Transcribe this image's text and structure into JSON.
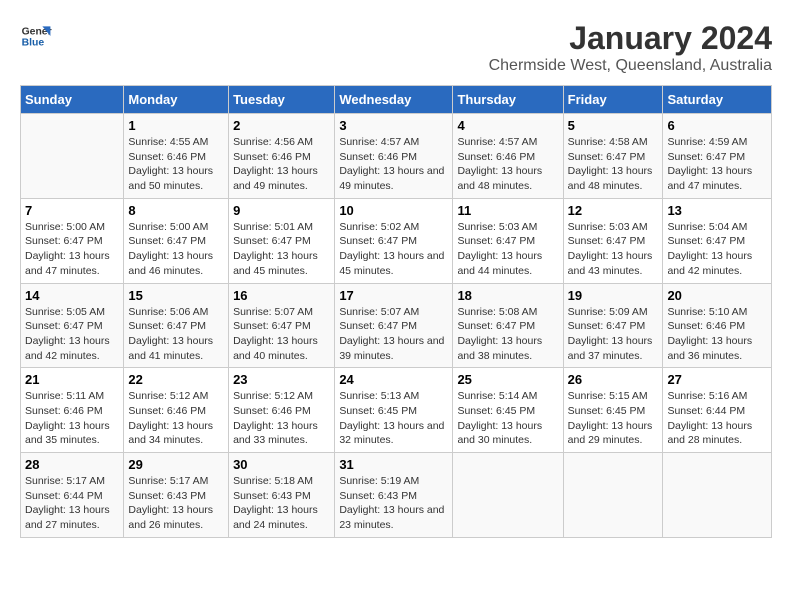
{
  "logo": {
    "line1": "General",
    "line2": "Blue"
  },
  "title": "January 2024",
  "subtitle": "Chermside West, Queensland, Australia",
  "headers": [
    "Sunday",
    "Monday",
    "Tuesday",
    "Wednesday",
    "Thursday",
    "Friday",
    "Saturday"
  ],
  "weeks": [
    [
      {
        "day": "",
        "sunrise": "",
        "sunset": "",
        "daylight": ""
      },
      {
        "day": "1",
        "sunrise": "Sunrise: 4:55 AM",
        "sunset": "Sunset: 6:46 PM",
        "daylight": "Daylight: 13 hours and 50 minutes."
      },
      {
        "day": "2",
        "sunrise": "Sunrise: 4:56 AM",
        "sunset": "Sunset: 6:46 PM",
        "daylight": "Daylight: 13 hours and 49 minutes."
      },
      {
        "day": "3",
        "sunrise": "Sunrise: 4:57 AM",
        "sunset": "Sunset: 6:46 PM",
        "daylight": "Daylight: 13 hours and 49 minutes."
      },
      {
        "day": "4",
        "sunrise": "Sunrise: 4:57 AM",
        "sunset": "Sunset: 6:46 PM",
        "daylight": "Daylight: 13 hours and 48 minutes."
      },
      {
        "day": "5",
        "sunrise": "Sunrise: 4:58 AM",
        "sunset": "Sunset: 6:47 PM",
        "daylight": "Daylight: 13 hours and 48 minutes."
      },
      {
        "day": "6",
        "sunrise": "Sunrise: 4:59 AM",
        "sunset": "Sunset: 6:47 PM",
        "daylight": "Daylight: 13 hours and 47 minutes."
      }
    ],
    [
      {
        "day": "7",
        "sunrise": "Sunrise: 5:00 AM",
        "sunset": "Sunset: 6:47 PM",
        "daylight": "Daylight: 13 hours and 47 minutes."
      },
      {
        "day": "8",
        "sunrise": "Sunrise: 5:00 AM",
        "sunset": "Sunset: 6:47 PM",
        "daylight": "Daylight: 13 hours and 46 minutes."
      },
      {
        "day": "9",
        "sunrise": "Sunrise: 5:01 AM",
        "sunset": "Sunset: 6:47 PM",
        "daylight": "Daylight: 13 hours and 45 minutes."
      },
      {
        "day": "10",
        "sunrise": "Sunrise: 5:02 AM",
        "sunset": "Sunset: 6:47 PM",
        "daylight": "Daylight: 13 hours and 45 minutes."
      },
      {
        "day": "11",
        "sunrise": "Sunrise: 5:03 AM",
        "sunset": "Sunset: 6:47 PM",
        "daylight": "Daylight: 13 hours and 44 minutes."
      },
      {
        "day": "12",
        "sunrise": "Sunrise: 5:03 AM",
        "sunset": "Sunset: 6:47 PM",
        "daylight": "Daylight: 13 hours and 43 minutes."
      },
      {
        "day": "13",
        "sunrise": "Sunrise: 5:04 AM",
        "sunset": "Sunset: 6:47 PM",
        "daylight": "Daylight: 13 hours and 42 minutes."
      }
    ],
    [
      {
        "day": "14",
        "sunrise": "Sunrise: 5:05 AM",
        "sunset": "Sunset: 6:47 PM",
        "daylight": "Daylight: 13 hours and 42 minutes."
      },
      {
        "day": "15",
        "sunrise": "Sunrise: 5:06 AM",
        "sunset": "Sunset: 6:47 PM",
        "daylight": "Daylight: 13 hours and 41 minutes."
      },
      {
        "day": "16",
        "sunrise": "Sunrise: 5:07 AM",
        "sunset": "Sunset: 6:47 PM",
        "daylight": "Daylight: 13 hours and 40 minutes."
      },
      {
        "day": "17",
        "sunrise": "Sunrise: 5:07 AM",
        "sunset": "Sunset: 6:47 PM",
        "daylight": "Daylight: 13 hours and 39 minutes."
      },
      {
        "day": "18",
        "sunrise": "Sunrise: 5:08 AM",
        "sunset": "Sunset: 6:47 PM",
        "daylight": "Daylight: 13 hours and 38 minutes."
      },
      {
        "day": "19",
        "sunrise": "Sunrise: 5:09 AM",
        "sunset": "Sunset: 6:47 PM",
        "daylight": "Daylight: 13 hours and 37 minutes."
      },
      {
        "day": "20",
        "sunrise": "Sunrise: 5:10 AM",
        "sunset": "Sunset: 6:46 PM",
        "daylight": "Daylight: 13 hours and 36 minutes."
      }
    ],
    [
      {
        "day": "21",
        "sunrise": "Sunrise: 5:11 AM",
        "sunset": "Sunset: 6:46 PM",
        "daylight": "Daylight: 13 hours and 35 minutes."
      },
      {
        "day": "22",
        "sunrise": "Sunrise: 5:12 AM",
        "sunset": "Sunset: 6:46 PM",
        "daylight": "Daylight: 13 hours and 34 minutes."
      },
      {
        "day": "23",
        "sunrise": "Sunrise: 5:12 AM",
        "sunset": "Sunset: 6:46 PM",
        "daylight": "Daylight: 13 hours and 33 minutes."
      },
      {
        "day": "24",
        "sunrise": "Sunrise: 5:13 AM",
        "sunset": "Sunset: 6:45 PM",
        "daylight": "Daylight: 13 hours and 32 minutes."
      },
      {
        "day": "25",
        "sunrise": "Sunrise: 5:14 AM",
        "sunset": "Sunset: 6:45 PM",
        "daylight": "Daylight: 13 hours and 30 minutes."
      },
      {
        "day": "26",
        "sunrise": "Sunrise: 5:15 AM",
        "sunset": "Sunset: 6:45 PM",
        "daylight": "Daylight: 13 hours and 29 minutes."
      },
      {
        "day": "27",
        "sunrise": "Sunrise: 5:16 AM",
        "sunset": "Sunset: 6:44 PM",
        "daylight": "Daylight: 13 hours and 28 minutes."
      }
    ],
    [
      {
        "day": "28",
        "sunrise": "Sunrise: 5:17 AM",
        "sunset": "Sunset: 6:44 PM",
        "daylight": "Daylight: 13 hours and 27 minutes."
      },
      {
        "day": "29",
        "sunrise": "Sunrise: 5:17 AM",
        "sunset": "Sunset: 6:43 PM",
        "daylight": "Daylight: 13 hours and 26 minutes."
      },
      {
        "day": "30",
        "sunrise": "Sunrise: 5:18 AM",
        "sunset": "Sunset: 6:43 PM",
        "daylight": "Daylight: 13 hours and 24 minutes."
      },
      {
        "day": "31",
        "sunrise": "Sunrise: 5:19 AM",
        "sunset": "Sunset: 6:43 PM",
        "daylight": "Daylight: 13 hours and 23 minutes."
      },
      {
        "day": "",
        "sunrise": "",
        "sunset": "",
        "daylight": ""
      },
      {
        "day": "",
        "sunrise": "",
        "sunset": "",
        "daylight": ""
      },
      {
        "day": "",
        "sunrise": "",
        "sunset": "",
        "daylight": ""
      }
    ]
  ]
}
